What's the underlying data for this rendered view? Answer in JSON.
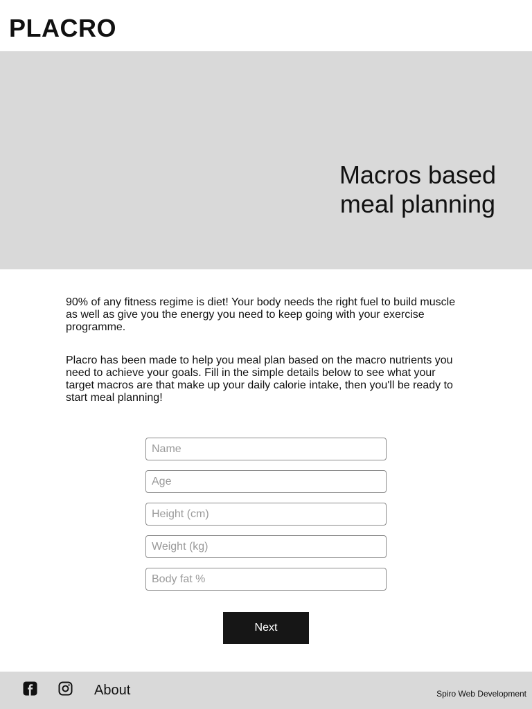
{
  "header": {
    "logo": "PLACRO"
  },
  "hero": {
    "title": "Macros based meal planning"
  },
  "intro": {
    "paragraph_1": "90% of any fitness regime is diet! Your body needs the right fuel to build muscle as well as give you the energy you need to keep going with your exercise programme.",
    "paragraph_2": "Placro has been made to help you meal plan based on the macro nutrients you need to achieve your goals. Fill in the simple details below to see what your target macros are that make up your daily calorie intake, then you'll be ready to start meal planning!"
  },
  "form": {
    "name_placeholder": "Name",
    "age_placeholder": "Age",
    "height_placeholder": "Height (cm)",
    "weight_placeholder": "Weight (kg)",
    "body_fat_placeholder": "Body fat %",
    "next_label": "Next"
  },
  "footer": {
    "icons": [
      "facebook-icon",
      "instagram-icon"
    ],
    "about_label": "About",
    "credit": "Spiro Web Development"
  },
  "colors": {
    "hero_background": "#d9d9d9",
    "button_background": "#161616",
    "button_text": "#ffffff"
  }
}
